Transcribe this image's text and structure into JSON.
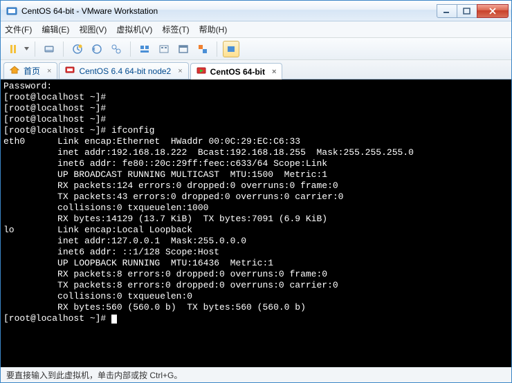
{
  "window": {
    "title": "CentOS 64-bit - VMware Workstation"
  },
  "menu": {
    "file": "文件(F)",
    "edit": "编辑(E)",
    "view": "视图(V)",
    "vm": "虚拟机(V)",
    "tabs": "标签(T)",
    "help": "帮助(H)"
  },
  "tabs": {
    "home": "首页",
    "node2": "CentOS 6.4 64-bit node2",
    "centos": "CentOS 64-bit"
  },
  "terminal": {
    "l0": "Password:",
    "l1": "[root@localhost ~]#",
    "l2": "[root@localhost ~]#",
    "l3": "[root@localhost ~]#",
    "l4": "[root@localhost ~]# ifconfig",
    "l5": "eth0      Link encap:Ethernet  HWaddr 00:0C:29:EC:C6:33",
    "l6": "          inet addr:192.168.18.222  Bcast:192.168.18.255  Mask:255.255.255.0",
    "l7": "          inet6 addr: fe80::20c:29ff:feec:c633/64 Scope:Link",
    "l8": "          UP BROADCAST RUNNING MULTICAST  MTU:1500  Metric:1",
    "l9": "          RX packets:124 errors:0 dropped:0 overruns:0 frame:0",
    "l10": "          TX packets:43 errors:0 dropped:0 overruns:0 carrier:0",
    "l11": "          collisions:0 txqueuelen:1000",
    "l12": "          RX bytes:14129 (13.7 KiB)  TX bytes:7091 (6.9 KiB)",
    "l13": "",
    "l14": "lo        Link encap:Local Loopback",
    "l15": "          inet addr:127.0.0.1  Mask:255.0.0.0",
    "l16": "          inet6 addr: ::1/128 Scope:Host",
    "l17": "          UP LOOPBACK RUNNING  MTU:16436  Metric:1",
    "l18": "          RX packets:8 errors:0 dropped:0 overruns:0 frame:0",
    "l19": "          TX packets:8 errors:0 dropped:0 overruns:0 carrier:0",
    "l20": "          collisions:0 txqueuelen:0",
    "l21": "          RX bytes:560 (560.0 b)  TX bytes:560 (560.0 b)",
    "l22": "",
    "l23": "[root@localhost ~]# "
  },
  "status": {
    "text": "要直接输入到此虚拟机，单击内部或按 Ctrl+G。"
  }
}
